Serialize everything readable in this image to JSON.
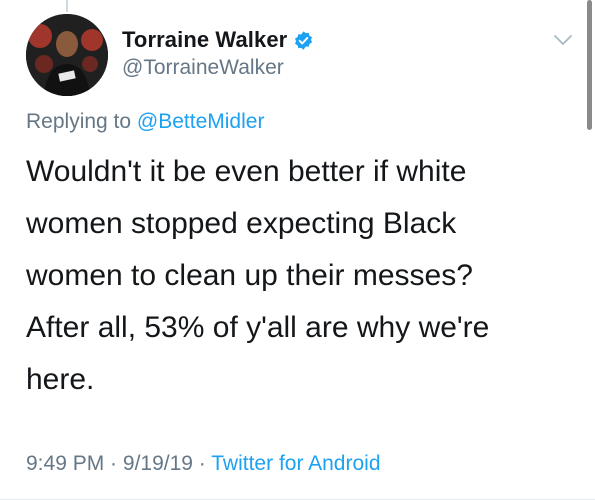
{
  "author": {
    "display_name": "Torraine Walker",
    "handle": "@TorraineWalker",
    "verified": true
  },
  "reply": {
    "prefix": "Replying to ",
    "mention": "@BetteMidler"
  },
  "tweet": {
    "lines": [
      "Wouldn't it be even better if white",
      "women stopped expecting Black",
      "women to clean up their messes?",
      "After all, 53% of y'all are why we're",
      "here."
    ]
  },
  "meta": {
    "time": "9:49 PM",
    "separator": " · ",
    "date": "9/19/19",
    "source": "Twitter for Android"
  },
  "colors": {
    "text": "#14171a",
    "secondary": "#657786",
    "accent": "#1da1f2"
  },
  "icons": {
    "verified": "verified-badge-icon",
    "caret": "chevron-down-icon"
  }
}
